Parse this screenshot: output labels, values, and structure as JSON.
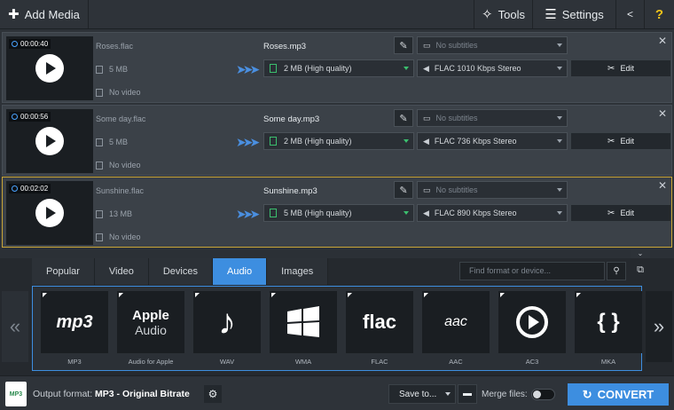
{
  "toolbar": {
    "add_media": "Add Media",
    "tools": "Tools",
    "settings": "Settings",
    "help": "?"
  },
  "files": [
    {
      "duration": "00:00:40",
      "source_name": "Roses.flac",
      "source_size": "5 MB",
      "source_video": "No video",
      "output_name": "Roses.mp3",
      "output_size": "2 MB (High quality)",
      "subtitles": "No subtitles",
      "audio": "FLAC 1010 Kbps Stereo",
      "edit": "Edit",
      "selected": false
    },
    {
      "duration": "00:00:56",
      "source_name": "Some day.flac",
      "source_size": "5 MB",
      "source_video": "No video",
      "output_name": "Some day.mp3",
      "output_size": "2 MB (High quality)",
      "subtitles": "No subtitles",
      "audio": "FLAC 736 Kbps Stereo",
      "edit": "Edit",
      "selected": false
    },
    {
      "duration": "00:02:02",
      "source_name": "Sunshine.flac",
      "source_size": "13 MB",
      "source_video": "No video",
      "output_name": "Sunshine.mp3",
      "output_size": "5 MB (High quality)",
      "subtitles": "No subtitles",
      "audio": "FLAC 890 Kbps Stereo",
      "edit": "Edit",
      "selected": true
    }
  ],
  "format_panel": {
    "tabs": [
      "Popular",
      "Video",
      "Devices",
      "Audio",
      "Images"
    ],
    "active_tab": "Audio",
    "search_placeholder": "Find format or device...",
    "formats": [
      {
        "caption": "MP3",
        "logo": "mp3"
      },
      {
        "caption": "Audio for Apple",
        "logo_line1": "Apple",
        "logo_line2": "Audio"
      },
      {
        "caption": "WAV",
        "logo": "music-note"
      },
      {
        "caption": "WMA",
        "logo": "windows"
      },
      {
        "caption": "FLAC",
        "logo": "flac"
      },
      {
        "caption": "AAC",
        "logo": "aac"
      },
      {
        "caption": "AC3",
        "logo": "play-circle"
      },
      {
        "caption": "MKA",
        "logo": "{ }"
      }
    ]
  },
  "bottom": {
    "output_label": "Output format:",
    "output_value": "MP3 - Original Bitrate",
    "save_to": "Save to...",
    "merge_files": "Merge files:",
    "merge_enabled": false,
    "convert": "CONVERT"
  },
  "colors": {
    "accent": "#3d8ee0",
    "selected_border": "#c9a537",
    "quality_green": "#3bbf6e"
  }
}
